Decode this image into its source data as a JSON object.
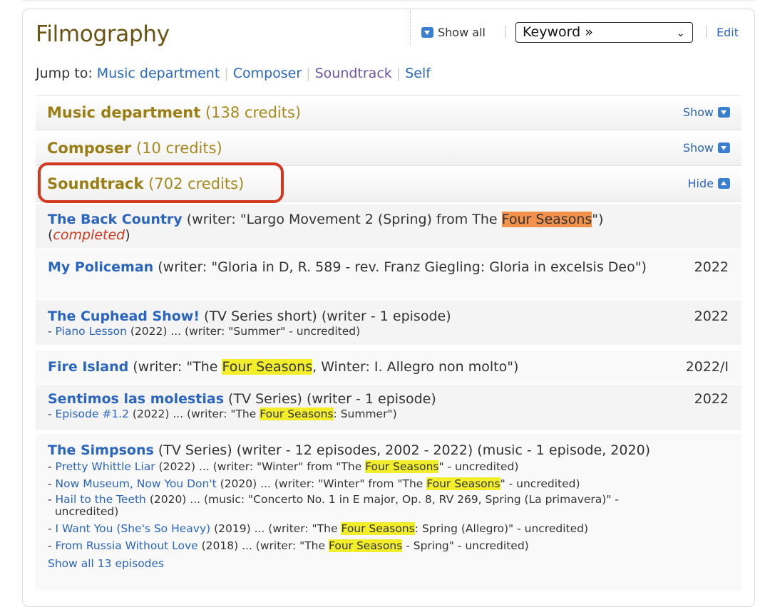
{
  "filmography": {
    "title": "Filmography",
    "show_all": "Show all",
    "keyword_select": "Keyword »",
    "edit": "Edit",
    "jump_label": "Jump to:",
    "jump_links": [
      "Music department",
      "Composer",
      "Soundtrack",
      "Self"
    ]
  },
  "sections": [
    {
      "name": "Music department",
      "credits": "(138 credits)",
      "toggle": "Show"
    },
    {
      "name": "Composer",
      "credits": "(10 credits)",
      "toggle": "Show"
    },
    {
      "name": "Soundtrack",
      "credits": "(702 credits)",
      "toggle": "Hide"
    }
  ],
  "credits": [
    {
      "title": "The Back Country",
      "pre": " (writer: \"Largo Movement 2 (Spring) from The ",
      "hl": "Four Seasons",
      "post": "\")",
      "status": "completed",
      "year": ""
    },
    {
      "title": "My Policeman",
      "detail": " (writer: \"Gloria in D, R. 589 - rev. Franz Giegling: Gloria in excelsis Deo\")",
      "year": "2022"
    },
    {
      "title": "The Cuphead Show!",
      "detail": " (TV Series short) (writer - 1 episode)",
      "year": "2022",
      "episode": {
        "name": "Piano Lesson",
        "text": " (2022) ... (writer: \"Summer\" - uncredited)"
      }
    },
    {
      "title": "Fire Island",
      "pre": " (writer: \"The ",
      "hl": "Four Seasons",
      "post": ", Winter: I. Allegro non molto\")",
      "year": "2022/I"
    },
    {
      "title": "Sentimos las molestias",
      "detail": " (TV Series) (writer - 1 episode)",
      "year": "2022",
      "episode": {
        "name": "Episode #1.2",
        "pre": " (2022) ... (writer: \"The ",
        "hl": "Four Seasons",
        "post": ": Summer\")"
      }
    },
    {
      "title": "The Simpsons",
      "detail": " (TV Series) (writer - 12 episodes, 2002 - 2022) (music - 1 episode, 2020)",
      "episodes": [
        {
          "name": "Pretty Whittle Liar",
          "pre": " (2022) ... (writer: \"Winter\" from \"The ",
          "hl": "Four Seasons",
          "post": "\" - uncredited)"
        },
        {
          "name": "Now Museum, Now You Don't",
          "pre": " (2020) ... (writer: \"Winter\" from \"The ",
          "hl": "Four Seasons",
          "post": "\" - uncredited)"
        },
        {
          "name": "Hail to the Teeth",
          "pre": " (2020) ... (music: \"Concerto No. 1 in E major, Op. 8, RV 269, Spring (La primavera)\" -",
          "post2": "uncredited)"
        },
        {
          "name": "I Want You (She's So Heavy)",
          "pre": " (2019) ... (writer: \"The ",
          "hl": "Four Seasons",
          "post": ": Spring (Allegro)\" - uncredited)"
        },
        {
          "name": "From Russia Without Love",
          "pre": " (2018) ... (writer: \"The ",
          "hl": "Four Seasons",
          "post": " - Spring\" - uncredited)"
        }
      ],
      "show_all": "Show all 13 episodes"
    }
  ],
  "colors": {
    "link": "#2a65c0",
    "section_heading": "#a68a1e",
    "title": "#6b5412",
    "highlight_yellow": "#f3ee2a",
    "highlight_orange": "#f2914b",
    "annotation_red": "#d3381e"
  }
}
